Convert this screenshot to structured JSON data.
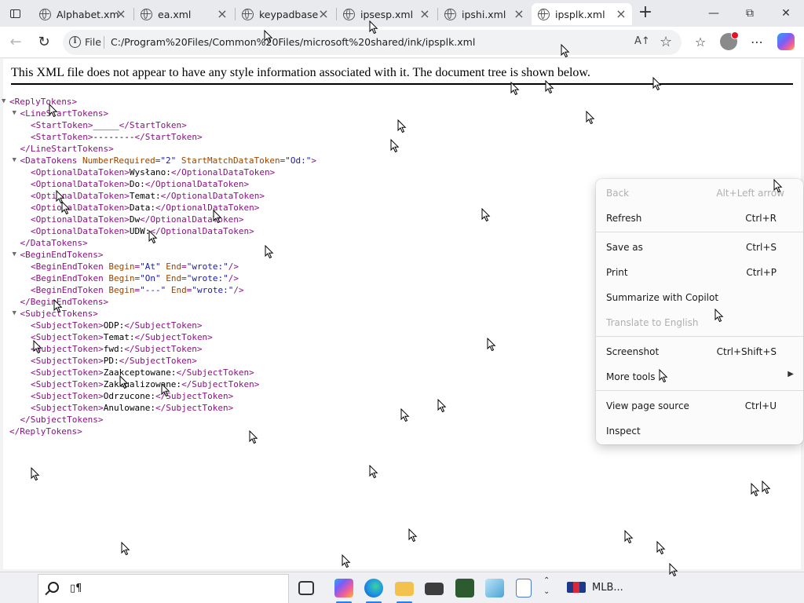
{
  "tabs": [
    {
      "title": "Alphabet.xml",
      "active": false
    },
    {
      "title": "ea.xml",
      "active": false
    },
    {
      "title": "keypadbase",
      "active": false
    },
    {
      "title": "ipsesp.xml",
      "active": false
    },
    {
      "title": "ipshi.xml",
      "active": false
    },
    {
      "title": "ipsplk.xml",
      "active": true
    }
  ],
  "addressbar": {
    "security_label": "File",
    "url": "C:/Program%20Files/Common%20Files/microsoft%20shared/ink/ipsplk.xml",
    "read_aloud": "A↑"
  },
  "page": {
    "notice": "This XML file does not appear to have any style information associated with it. The document tree is shown below.",
    "tree": [
      {
        "toggle": "▼",
        "parts": [
          [
            "tw",
            "<ReplyTokens>"
          ]
        ]
      },
      {
        "toggle": "▼",
        "parts": [
          [
            "tw",
            "<LineStartTokens>"
          ]
        ]
      },
      {
        "toggle": "",
        "parts": [
          [
            "tw",
            "<StartToken>"
          ],
          [
            "tt",
            "_____"
          ],
          [
            "tw",
            "</StartToken>"
          ]
        ]
      },
      {
        "toggle": "",
        "parts": [
          [
            "tw",
            "<StartToken>"
          ],
          [
            "tt",
            "--------"
          ],
          [
            "tw",
            "</StartToken>"
          ]
        ]
      },
      {
        "toggle": "",
        "parts": [
          [
            "tw",
            "</LineStartTokens>"
          ]
        ]
      },
      {
        "toggle": "▼",
        "parts": [
          [
            "tw",
            "<DataTokens "
          ],
          [
            "ta",
            "NumberRequired"
          ],
          [
            "tw",
            "="
          ],
          [
            "tv",
            "\"2\""
          ],
          [
            "tw",
            " "
          ],
          [
            "ta",
            "StartMatchDataToken"
          ],
          [
            "tw",
            "="
          ],
          [
            "tv",
            "\"Od:\""
          ],
          [
            "tw",
            ">"
          ]
        ]
      },
      {
        "toggle": "",
        "parts": [
          [
            "tw",
            "<OptionalDataToken>"
          ],
          [
            "tt",
            "Wysłano:"
          ],
          [
            "tw",
            "</OptionalDataToken>"
          ]
        ]
      },
      {
        "toggle": "",
        "parts": [
          [
            "tw",
            "<OptionalDataToken>"
          ],
          [
            "tt",
            "Do:"
          ],
          [
            "tw",
            "</OptionalDataToken>"
          ]
        ]
      },
      {
        "toggle": "",
        "parts": [
          [
            "tw",
            "<OptionalDataToken>"
          ],
          [
            "tt",
            "Temat:"
          ],
          [
            "tw",
            "</OptionalDataToken>"
          ]
        ]
      },
      {
        "toggle": "",
        "parts": [
          [
            "tw",
            "<OptionalDataToken>"
          ],
          [
            "tt",
            "Data:"
          ],
          [
            "tw",
            "</OptionalDataToken>"
          ]
        ]
      },
      {
        "toggle": "",
        "parts": [
          [
            "tw",
            "<OptionalDataToken>"
          ],
          [
            "tt",
            "Dw"
          ],
          [
            "tw",
            "</OptionalDataToken>"
          ]
        ]
      },
      {
        "toggle": "",
        "parts": [
          [
            "tw",
            "<OptionalDataToken>"
          ],
          [
            "tt",
            "UDW:"
          ],
          [
            "tw",
            "</OptionalDataToken>"
          ]
        ]
      },
      {
        "toggle": "",
        "parts": [
          [
            "tw",
            "</DataTokens>"
          ]
        ]
      },
      {
        "toggle": "▼",
        "parts": [
          [
            "tw",
            "<BeginEndTokens>"
          ]
        ]
      },
      {
        "toggle": "",
        "parts": [
          [
            "tw",
            "<BeginEndToken "
          ],
          [
            "ta",
            "Begin"
          ],
          [
            "tw",
            "="
          ],
          [
            "tv",
            "\"At\""
          ],
          [
            "tw",
            " "
          ],
          [
            "ta",
            "End"
          ],
          [
            "tw",
            "="
          ],
          [
            "tv",
            "\"wrote:\""
          ],
          [
            "tw",
            "/>"
          ]
        ]
      },
      {
        "toggle": "",
        "parts": [
          [
            "tw",
            "<BeginEndToken "
          ],
          [
            "ta",
            "Begin"
          ],
          [
            "tw",
            "="
          ],
          [
            "tv",
            "\"On\""
          ],
          [
            "tw",
            " "
          ],
          [
            "ta",
            "End"
          ],
          [
            "tw",
            "="
          ],
          [
            "tv",
            "\"wrote:\""
          ],
          [
            "tw",
            "/>"
          ]
        ]
      },
      {
        "toggle": "",
        "parts": [
          [
            "tw",
            "<BeginEndToken "
          ],
          [
            "ta",
            "Begin"
          ],
          [
            "tw",
            "="
          ],
          [
            "tv",
            "\"---\""
          ],
          [
            "tw",
            " "
          ],
          [
            "ta",
            "End"
          ],
          [
            "tw",
            "="
          ],
          [
            "tv",
            "\"wrote:\""
          ],
          [
            "tw",
            "/>"
          ]
        ]
      },
      {
        "toggle": "",
        "parts": [
          [
            "tw",
            "</BeginEndTokens>"
          ]
        ]
      },
      {
        "toggle": "▼",
        "parts": [
          [
            "tw",
            "<SubjectTokens>"
          ]
        ]
      },
      {
        "toggle": "",
        "parts": [
          [
            "tw",
            "<SubjectToken>"
          ],
          [
            "tt",
            "ODP:"
          ],
          [
            "tw",
            "</SubjectToken>"
          ]
        ]
      },
      {
        "toggle": "",
        "parts": [
          [
            "tw",
            "<SubjectToken>"
          ],
          [
            "tt",
            "Temat:"
          ],
          [
            "tw",
            "</SubjectToken>"
          ]
        ]
      },
      {
        "toggle": "",
        "parts": [
          [
            "tw",
            "<SubjectToken>"
          ],
          [
            "tt",
            "fwd:"
          ],
          [
            "tw",
            "</SubjectToken>"
          ]
        ]
      },
      {
        "toggle": "",
        "parts": [
          [
            "tw",
            "<SubjectToken>"
          ],
          [
            "tt",
            "PD:"
          ],
          [
            "tw",
            "</SubjectToken>"
          ]
        ]
      },
      {
        "toggle": "",
        "parts": [
          [
            "tw",
            "<SubjectToken>"
          ],
          [
            "tt",
            "Zaakceptowane:"
          ],
          [
            "tw",
            "</SubjectToken>"
          ]
        ]
      },
      {
        "toggle": "",
        "parts": [
          [
            "tw",
            "<SubjectToken>"
          ],
          [
            "tt",
            "Zaktualizowane:"
          ],
          [
            "tw",
            "</SubjectToken>"
          ]
        ]
      },
      {
        "toggle": "",
        "parts": [
          [
            "tw",
            "<SubjectToken>"
          ],
          [
            "tt",
            "Odrzucone:"
          ],
          [
            "tw",
            "</SubjectToken>"
          ]
        ]
      },
      {
        "toggle": "",
        "parts": [
          [
            "tw",
            "<SubjectToken>"
          ],
          [
            "tt",
            "Anulowane:"
          ],
          [
            "tw",
            "</SubjectToken>"
          ]
        ]
      },
      {
        "toggle": "",
        "parts": [
          [
            "tw",
            "</SubjectTokens>"
          ]
        ]
      },
      {
        "toggle": "",
        "parts": [
          [
            "tw",
            "</ReplyTokens>"
          ]
        ]
      }
    ]
  },
  "context_menu": {
    "back_label": "Back",
    "back_shortcut": "Alt+Left arrow",
    "refresh_label": "Refresh",
    "refresh_shortcut": "Ctrl+R",
    "saveas_label": "Save as",
    "saveas_shortcut": "Ctrl+S",
    "print_label": "Print",
    "print_shortcut": "Ctrl+P",
    "summarize_label": "Summarize with Copilot",
    "translate_label": "Translate to English",
    "screenshot_label": "Screenshot",
    "screenshot_shortcut": "Ctrl+Shift+S",
    "moretools_label": "More tools",
    "viewsource_label": "View page source",
    "viewsource_shortcut": "Ctrl+U",
    "inspect_label": "Inspect"
  },
  "taskbar": {
    "search_text": "▯¶",
    "mlb_label": "MLB..."
  },
  "colors": {
    "tag": "#881280",
    "attr_name": "#994500",
    "attr_value": "#1a1aa6",
    "tab_active_bg": "#ffffff",
    "tabstrip_bg": "#e9eaed",
    "taskbar_accent": "#2b7de9"
  },
  "icons": {
    "tab_actions": "tab-actions-icon",
    "tab_favicon": "globe-icon",
    "nav_back": "back-arrow-icon",
    "nav_refresh": "refresh-icon",
    "info": "info-icon",
    "favorite": "star-icon",
    "favorites_bar": "favorites-icon",
    "more": "ellipsis-icon"
  }
}
